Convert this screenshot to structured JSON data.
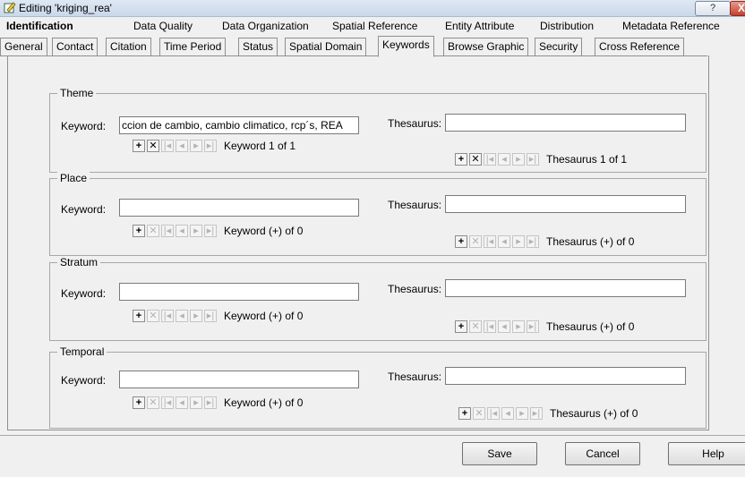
{
  "window": {
    "title": "Editing 'kriging_rea'",
    "help_label": "?",
    "close_label": "X"
  },
  "main_tabs": [
    "Identification",
    "Data Quality",
    "Data Organization",
    "Spatial Reference",
    "Entity Attribute",
    "Distribution",
    "Metadata Reference"
  ],
  "sub_tabs": [
    "General",
    "Contact",
    "Citation",
    "Time Period",
    "Status",
    "Spatial Domain",
    "Keywords",
    "Browse Graphic",
    "Security",
    "Cross Reference"
  ],
  "labels": {
    "keyword": "Keyword:",
    "thesaurus": "Thesaurus:"
  },
  "groups": [
    {
      "title": "Theme",
      "keyword_value": "ccion de cambio, cambio climatico, rcp´s, REA",
      "keyword_counter": "Keyword 1 of 1",
      "thesaurus_value": "",
      "thesaurus_counter": "Thesaurus 1 of 1"
    },
    {
      "title": "Place",
      "keyword_value": "",
      "keyword_counter": "Keyword (+) of 0",
      "thesaurus_value": "",
      "thesaurus_counter": "Thesaurus (+) of 0"
    },
    {
      "title": "Stratum",
      "keyword_value": "",
      "keyword_counter": "Keyword (+) of 0",
      "thesaurus_value": "",
      "thesaurus_counter": "Thesaurus (+) of 0"
    },
    {
      "title": "Temporal",
      "keyword_value": "",
      "keyword_counter": "Keyword (+) of 0",
      "thesaurus_value": "",
      "thesaurus_counter": "Thesaurus (+) of 0"
    }
  ],
  "nav_glyphs": {
    "add": "+",
    "delete": "✕",
    "first": "|◂",
    "prev": "◂",
    "next": "▸",
    "last": "▸|"
  },
  "buttons": {
    "save": "Save",
    "cancel": "Cancel",
    "help": "Help"
  }
}
